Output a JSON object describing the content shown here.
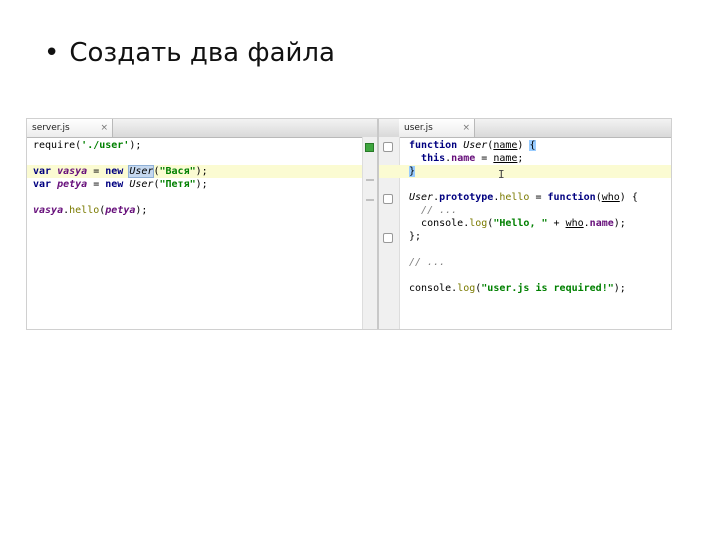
{
  "slide": {
    "bullet": "•",
    "title": "Создать два файла"
  },
  "left_pane": {
    "tab_label": "server.js",
    "tab_close": "×",
    "lines": [
      {
        "l1": "require(",
        "l2": "'./user'",
        "l3": ");"
      },
      {
        "var": "var",
        "name": "vasya",
        "eq": " = ",
        "new": "new",
        "cls": "User",
        "open": "(",
        "str": "\"Вася\"",
        "close": ");"
      },
      {
        "var": "var",
        "name": "petya",
        "eq": " = ",
        "new": "new",
        "cls": "User",
        "open": "(",
        "str": "\"Петя\"",
        "close": ");"
      },
      {
        "obj": "vasya",
        "dot": ".",
        "method": "hello",
        "open": "(",
        "arg": "petya",
        "close": ");"
      }
    ]
  },
  "right_pane": {
    "tab_label": "user.js",
    "tab_close": "×",
    "lines": {
      "l1_kw": "function",
      "l1_name": "User",
      "l1_open": "(",
      "l1_param": "name",
      "l1_close": ") ",
      "l1_brace": "{",
      "l2_this": "this",
      "l2_dot": ".",
      "l2_prop": "name",
      "l2_eq": " = ",
      "l2_val": "name",
      "l2_end": ";",
      "l3_brace": "}",
      "l5_cls": "User",
      "l5_dot1": ".",
      "l5_proto": "prototype",
      "l5_dot2": ".",
      "l5_method": "hello",
      "l5_eq": " = ",
      "l5_kw": "function",
      "l5_open": "(",
      "l5_param": "who",
      "l5_close": ") {",
      "l6_cmt": "// ...",
      "l7_obj": "console",
      "l7_dot": ".",
      "l7_fn": "log",
      "l7_open": "(",
      "l7_str": "\"Hello, \"",
      "l7_plus": " + ",
      "l7_who": "who",
      "l7_dot2": ".",
      "l7_prop": "name",
      "l7_close": ");",
      "l8_end": "};",
      "l10_cmt": "// ...",
      "l12_obj": "console",
      "l12_dot": ".",
      "l12_fn": "log",
      "l12_open": "(",
      "l12_str": "\"user.js is required!\"",
      "l12_close": ");"
    }
  },
  "cursor_glyph": "I"
}
